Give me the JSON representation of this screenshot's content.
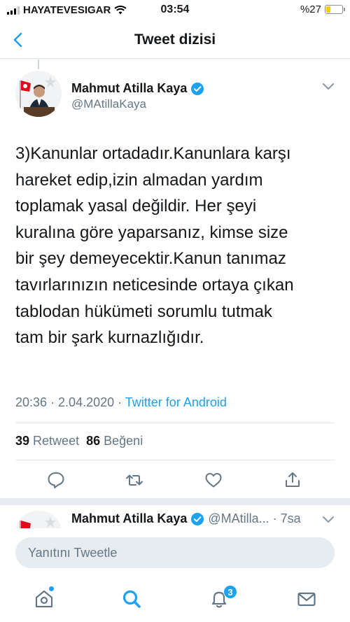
{
  "status_bar": {
    "carrier": "HAYATEVESIGAR",
    "time": "03:54",
    "battery_text": "%27",
    "battery_level": 0.27,
    "icons": [
      "signal-icon",
      "wifi-icon",
      "battery-icon"
    ]
  },
  "nav": {
    "title": "Tweet dizisi",
    "back_icon": "chevron-left-icon"
  },
  "tweet": {
    "author_name": "Mahmut Atilla Kaya",
    "handle": "@MAtillaKaya",
    "verified": true,
    "text": "3)Kanunlar ortadadır.Kanunlara karşı\nhareket edip,izin almadan yardım\ntoplamak yasal değildir. Her şeyi\nkuralına göre yaparsanız, kimse size\nbir şey demeyecektir.Kanun tanımaz\ntavırlarınızın neticesinde ortaya çıkan\ntablodan hükümeti sorumlu tutmak\ntam bir şark kurnazlığıdır.",
    "timestamp": "20:36 · 2.04.2020 · ",
    "source": "Twitter for Android",
    "retweet_count": "39",
    "retweet_label": "Retweet",
    "like_count": "86",
    "like_label": "Beğeni",
    "actions": [
      "reply-icon",
      "retweet-icon",
      "like-icon",
      "share-icon"
    ]
  },
  "reply_preview": {
    "author_name": "Mahmut Atilla Kaya",
    "handle_time": "@MAtilla... · 7sa"
  },
  "composer": {
    "placeholder": "Yanıtını Tweetle"
  },
  "tab_bar": {
    "items": [
      "home-icon",
      "search-icon",
      "notifications-icon",
      "messages-icon"
    ],
    "notification_badge": "3"
  },
  "colors": {
    "accent": "#1da1f2",
    "text": "#14171a",
    "secondary": "#657786",
    "battery": "#ffcc00"
  }
}
